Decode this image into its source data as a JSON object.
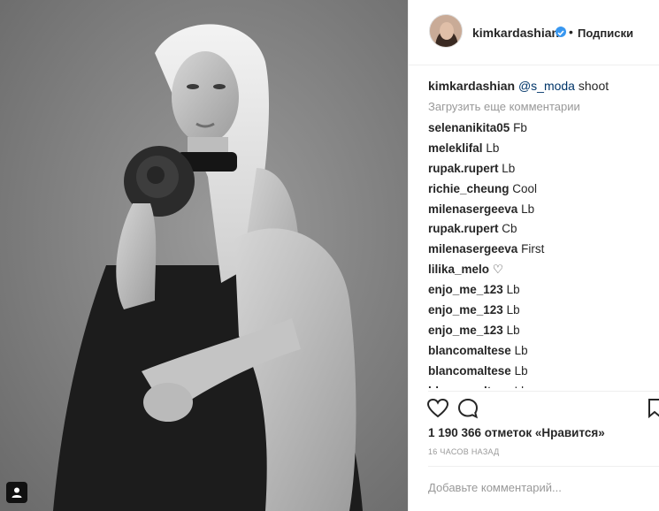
{
  "post": {
    "username": "kimkardashian",
    "follow_label": "Подписки",
    "separator": "•",
    "verified_icon": "verified-badge-icon",
    "caption": {
      "username": "kimkardashian",
      "mention": "@s_moda",
      "text": " shoot"
    },
    "load_more": "Загрузить еще комментарии",
    "comments": [
      {
        "user": "selenanikita05",
        "text": "Fb"
      },
      {
        "user": "meleklifal",
        "text": "Lb"
      },
      {
        "user": "rupak.rupert",
        "text": "Lb"
      },
      {
        "user": "richie_cheung",
        "text": "Cool"
      },
      {
        "user": "milenasergeeva",
        "text": "Lb"
      },
      {
        "user": "rupak.rupert",
        "text": "Cb"
      },
      {
        "user": "milenasergeeva",
        "text": "First"
      },
      {
        "user": "lilika_melo",
        "text": "♡"
      },
      {
        "user": "enjo_me_123",
        "text": "Lb"
      },
      {
        "user": "enjo_me_123",
        "text": "Lb"
      },
      {
        "user": "enjo_me_123",
        "text": "Lb"
      },
      {
        "user": "blancomaltese",
        "text": "Lb"
      },
      {
        "user": "blancomaltese",
        "text": "Lb"
      },
      {
        "user": "blancomaltese",
        "text": "Lb"
      }
    ],
    "likes": "1 190 366 отметок «Нравится»",
    "time_ago": "16 ЧАСОВ НАЗАД",
    "comment_placeholder": "Добавьте комментарий...",
    "icons": {
      "like": "heart-icon",
      "comment": "comment-bubble-icon",
      "save": "bookmark-icon",
      "user_tag": "person-icon"
    },
    "colors": {
      "verified": "#3897f0",
      "mention": "#003569",
      "muted": "#999999",
      "text": "#262626"
    }
  }
}
